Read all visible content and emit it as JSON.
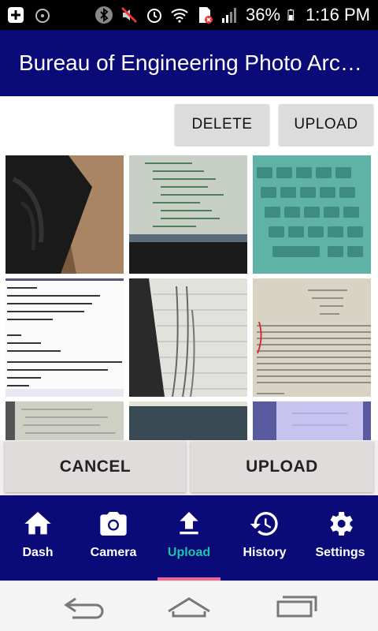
{
  "status_bar": {
    "battery_percent": "36%",
    "time": "1:16 PM",
    "icons": [
      "add-icon",
      "alarm-clock-icon",
      "bluetooth-icon",
      "mute-icon",
      "alarm-icon",
      "wifi-icon",
      "sim-error-icon",
      "signal-icon",
      "battery-icon"
    ]
  },
  "app_bar": {
    "title": "Bureau of Engineering Photo Archive"
  },
  "top_actions": {
    "delete_label": "DELETE",
    "upload_label": "UPLOAD"
  },
  "photo_grid": {
    "photos": [
      {
        "subject": "laptop edge and wooden desk"
      },
      {
        "subject": "monitor with code editor"
      },
      {
        "subject": "teal keyboard"
      },
      {
        "subject": "code snippet printout"
      },
      {
        "subject": "handwritten notebook page"
      },
      {
        "subject": "printed lab report"
      },
      {
        "subject": "handwritten notes"
      },
      {
        "subject": "dark photo"
      },
      {
        "subject": "illuminated gel plate"
      }
    ]
  },
  "bottom_actions": {
    "cancel_label": "CANCEL",
    "upload_label": "UPLOAD"
  },
  "bottom_nav": {
    "items": [
      {
        "label": "Dash",
        "icon": "home-icon",
        "active": false
      },
      {
        "label": "Camera",
        "icon": "camera-icon",
        "active": false
      },
      {
        "label": "Upload",
        "icon": "upload-icon",
        "active": true
      },
      {
        "label": "History",
        "icon": "history-icon",
        "active": false
      },
      {
        "label": "Settings",
        "icon": "gear-icon",
        "active": false
      }
    ]
  },
  "colors": {
    "primary": "#0a0a78",
    "accent": "#1bc6a7",
    "indicator": "#e86a92"
  }
}
